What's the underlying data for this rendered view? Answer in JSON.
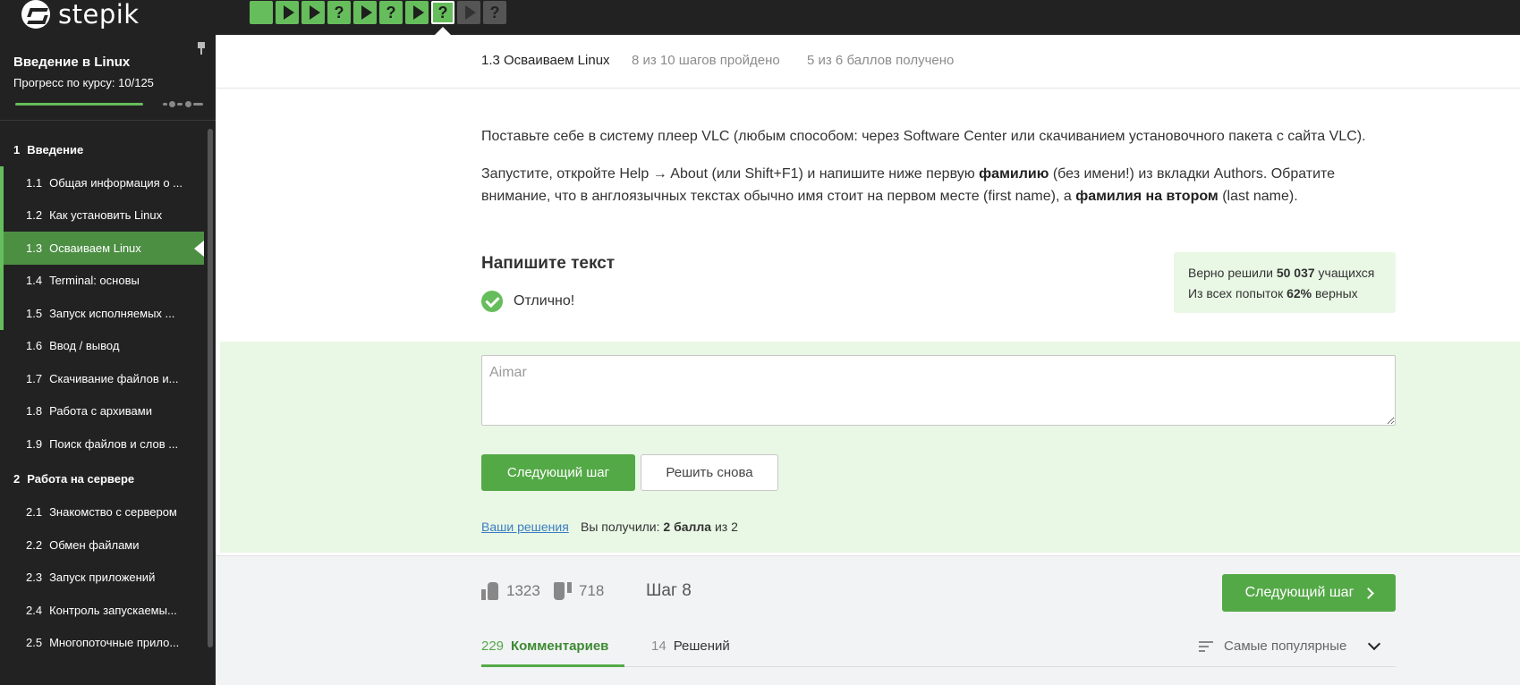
{
  "app": {
    "logo_text": "stepik"
  },
  "step_nav": [
    {
      "kind": "square",
      "state": "done"
    },
    {
      "kind": "play",
      "state": "done"
    },
    {
      "kind": "play",
      "state": "done"
    },
    {
      "kind": "question",
      "state": "done",
      "glyph": "?"
    },
    {
      "kind": "play",
      "state": "done"
    },
    {
      "kind": "question",
      "state": "done",
      "glyph": "?"
    },
    {
      "kind": "play",
      "state": "done"
    },
    {
      "kind": "question",
      "state": "active",
      "glyph": "?"
    },
    {
      "kind": "play",
      "state": "todo"
    },
    {
      "kind": "question",
      "state": "todo",
      "glyph": "?"
    }
  ],
  "sidebar": {
    "course_title": "Введение в Linux",
    "progress_text": "Прогресс по курсу:  10/125",
    "progress_fraction": 0.08,
    "modules": [
      {
        "number": "1",
        "title": "Введение",
        "lessons": [
          {
            "number": "1.1",
            "title": "Общая информация о ...",
            "state": "done"
          },
          {
            "number": "1.2",
            "title": "Как установить Linux",
            "state": "done"
          },
          {
            "number": "1.3",
            "title": "Осваиваем Linux",
            "state": "current"
          },
          {
            "number": "1.4",
            "title": "Terminal: основы",
            "state": "done"
          },
          {
            "number": "1.5",
            "title": "Запуск исполняемых ...",
            "state": "done"
          },
          {
            "number": "1.6",
            "title": "Ввод / вывод",
            "state": "todo"
          },
          {
            "number": "1.7",
            "title": "Скачивание файлов и...",
            "state": "todo"
          },
          {
            "number": "1.8",
            "title": "Работа с архивами",
            "state": "todo"
          },
          {
            "number": "1.9",
            "title": "Поиск файлов и слов ...",
            "state": "todo"
          }
        ]
      },
      {
        "number": "2",
        "title": "Работа на сервере",
        "lessons": [
          {
            "number": "2.1",
            "title": "Знакомство с сервером",
            "state": "todo"
          },
          {
            "number": "2.2",
            "title": "Обмен файлами",
            "state": "todo"
          },
          {
            "number": "2.3",
            "title": "Запуск приложений",
            "state": "todo"
          },
          {
            "number": "2.4",
            "title": "Контроль запускаемы...",
            "state": "todo"
          },
          {
            "number": "2.5",
            "title": "Многопоточные прило...",
            "state": "todo"
          }
        ]
      }
    ]
  },
  "lesson_header": {
    "title": "1.3 Осваиваем Linux",
    "steps_passed": "8 из 10 шагов пройдено",
    "points": "5 из 6 баллов  получено"
  },
  "task": {
    "p1": "Поставьте себе в систему плеер VLC (любым способом: через Software Center или скачиванием установочного пакета с сайта VLC).",
    "p2_a": "Запустите, откройте Help → About (или Shift+F1) и напишите ниже первую ",
    "p2_b": "фамилию",
    "p2_c": " (без имени!) из вкладки Authors. Обратите внимание, что в англоязычных текстах обычно имя стоит на первом месте (first name), а ",
    "p2_d": "фамилия на втором",
    "p2_e": " (last name)."
  },
  "quiz": {
    "title": "Напишите текст",
    "feedback": "Отлично!",
    "stats_line1_a": "Верно решили ",
    "stats_line1_b": "50 037",
    "stats_line1_c": " учащихся",
    "stats_line2_a": "Из всех попыток ",
    "stats_line2_b": "62%",
    "stats_line2_c": " верных",
    "answer_value": "Aimar",
    "next_button": "Следующий шаг",
    "retry_button": "Решить снова",
    "your_solutions_link": "Ваши решения",
    "received_a": "Вы получили: ",
    "received_b": "2 балла",
    "received_c": " из 2"
  },
  "footer": {
    "likes": "1323",
    "dislikes": "718",
    "step_label": "Шаг 8",
    "next_button": "Следующий шаг",
    "comments_count": "229",
    "comments_label": "Комментариев",
    "solutions_count": "14",
    "solutions_label": "Решений",
    "sort_label": "Самые популярные"
  },
  "colors": {
    "accent_green": "#54a947",
    "step_green": "#66bd5b",
    "dark_bg": "#222222",
    "answer_bg": "#e9f7e5"
  }
}
